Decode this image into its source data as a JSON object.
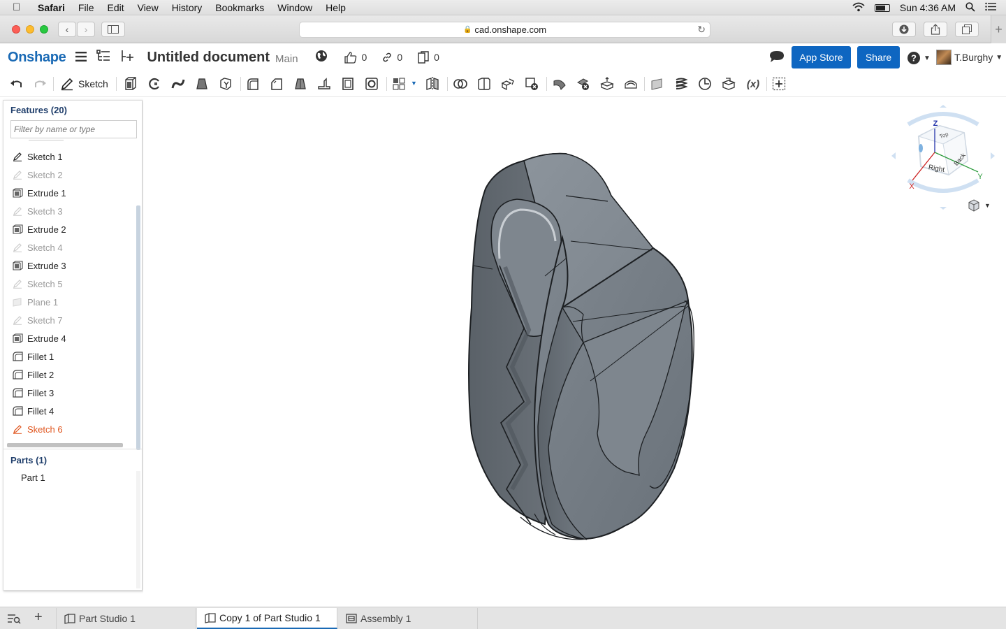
{
  "menubar": {
    "app": "Safari",
    "items": [
      "File",
      "Edit",
      "View",
      "History",
      "Bookmarks",
      "Window",
      "Help"
    ],
    "clock": "Sun 4:36 AM"
  },
  "browser": {
    "url": "cad.onshape.com"
  },
  "header": {
    "logo": "Onshape",
    "doc_title": "Untitled document",
    "branch": "Main",
    "likes": "0",
    "links": "0",
    "copies": "0",
    "app_store_label": "App Store",
    "share_label": "Share",
    "user": "T.Burghy"
  },
  "toolbar": {
    "sketch_label": "Sketch",
    "variable_label": "(x)"
  },
  "features": {
    "title": "Features (20)",
    "filter_placeholder": "Filter by name or type",
    "items": [
      {
        "label": "Sketch 1",
        "icon": "sketch-icon",
        "state": "normal"
      },
      {
        "label": "Sketch 2",
        "icon": "sketch-icon",
        "state": "dim"
      },
      {
        "label": "Extrude 1",
        "icon": "extrude-icon",
        "state": "normal"
      },
      {
        "label": "Sketch 3",
        "icon": "sketch-icon",
        "state": "dim"
      },
      {
        "label": "Extrude 2",
        "icon": "extrude-icon",
        "state": "normal"
      },
      {
        "label": "Sketch 4",
        "icon": "sketch-icon",
        "state": "dim"
      },
      {
        "label": "Extrude 3",
        "icon": "extrude-icon",
        "state": "normal"
      },
      {
        "label": "Sketch 5",
        "icon": "sketch-icon",
        "state": "dim"
      },
      {
        "label": "Plane 1",
        "icon": "plane-icon",
        "state": "dim"
      },
      {
        "label": "Sketch 7",
        "icon": "sketch-icon",
        "state": "dim"
      },
      {
        "label": "Extrude 4",
        "icon": "extrude-icon",
        "state": "normal"
      },
      {
        "label": "Fillet 1",
        "icon": "fillet-icon",
        "state": "normal"
      },
      {
        "label": "Fillet 2",
        "icon": "fillet-icon",
        "state": "normal"
      },
      {
        "label": "Fillet 3",
        "icon": "fillet-icon",
        "state": "normal"
      },
      {
        "label": "Fillet 4",
        "icon": "fillet-icon",
        "state": "normal"
      },
      {
        "label": "Sketch 6",
        "icon": "sketch-icon",
        "state": "active"
      }
    ]
  },
  "parts": {
    "title": "Parts (1)",
    "items": [
      "Part 1"
    ]
  },
  "viewcube": {
    "z": "Z",
    "x": "X",
    "y": "Y",
    "right": "Right",
    "back": "Back",
    "top": "Top"
  },
  "tabs": [
    "Part Studio 1",
    "Copy 1 of Part Studio 1",
    "Assembly 1"
  ],
  "colors": {
    "brand": "#1a6ab5",
    "button": "#0e66c1",
    "active_feature": "#e0561f",
    "model": "#6f7780"
  }
}
